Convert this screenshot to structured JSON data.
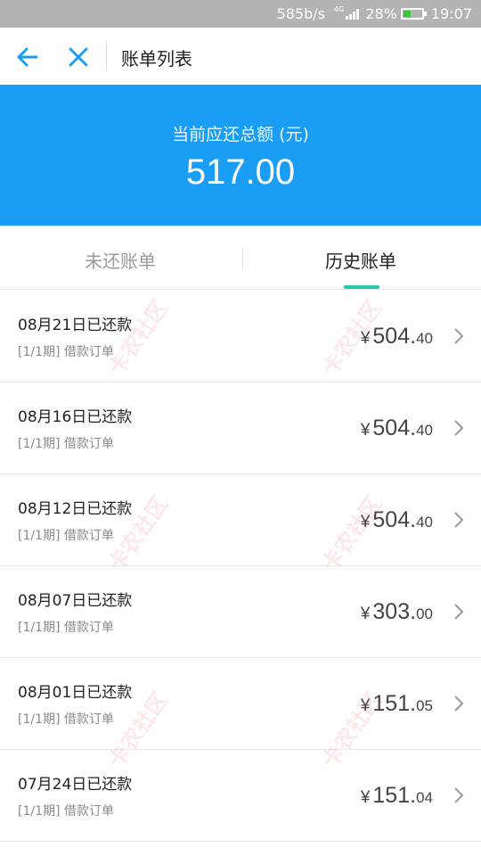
{
  "statusbar": {
    "speed": "585b/s",
    "network": "4G",
    "battery": "28%",
    "battery_level": 0.28,
    "time": "19:07"
  },
  "navbar": {
    "back_icon": "arrow-left-icon",
    "close_icon": "close-icon",
    "title": "账单列表"
  },
  "summary": {
    "label": "当前应还总额 (元)",
    "amount": "517.00"
  },
  "tabs": [
    {
      "label": "未还账单",
      "active": false
    },
    {
      "label": "历史账单",
      "active": true
    }
  ],
  "bills": [
    {
      "title": "08月21日已还款",
      "subtitle": "[1/1期] 借款订单",
      "currency": "¥",
      "int": "504",
      "dec": "40"
    },
    {
      "title": "08月16日已还款",
      "subtitle": "[1/1期] 借款订单",
      "currency": "¥",
      "int": "504",
      "dec": "40"
    },
    {
      "title": "08月12日已还款",
      "subtitle": "[1/1期] 借款订单",
      "currency": "¥",
      "int": "504",
      "dec": "40"
    },
    {
      "title": "08月07日已还款",
      "subtitle": "[1/1期] 借款订单",
      "currency": "¥",
      "int": "303",
      "dec": "00"
    },
    {
      "title": "08月01日已还款",
      "subtitle": "[1/1期] 借款订单",
      "currency": "¥",
      "int": "151",
      "dec": "05"
    },
    {
      "title": "07月24日已还款",
      "subtitle": "[1/1期] 借款订单",
      "currency": "¥",
      "int": "151",
      "dec": "04"
    }
  ],
  "watermark": "卡农社区",
  "colors": {
    "primary": "#1a9df5",
    "tab_indicator": "#26c6a6",
    "nav_icon": "#1a9df5"
  }
}
